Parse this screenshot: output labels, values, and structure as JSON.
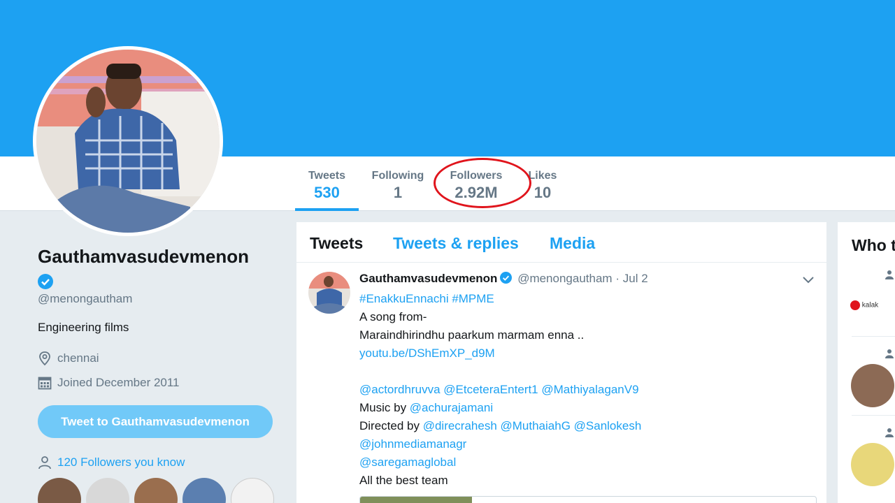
{
  "colors": {
    "brand_blue": "#1da1f2",
    "banner": "#1da1f2",
    "annotation_red": "#e0141c",
    "muted_text": "#657786"
  },
  "nav": {
    "stats": [
      {
        "label": "Tweets",
        "value": "530"
      },
      {
        "label": "Following",
        "value": "1"
      },
      {
        "label": "Followers",
        "value": "2.92M"
      },
      {
        "label": "Likes",
        "value": "10"
      }
    ],
    "active": "Tweets"
  },
  "profile": {
    "name": "Gauthamvasudevmenon",
    "handle": "@menongautham",
    "bio": "Engineering films",
    "location": "chennai",
    "joined": "Joined December 2011",
    "tweet_to_label": "Tweet to Gauthamvasudevmenon",
    "followers_you_know": "120 Followers you know"
  },
  "timeline": {
    "tabs": [
      "Tweets",
      "Tweets & replies",
      "Media"
    ],
    "tweet": {
      "author": "Gauthamvasudevmenon",
      "handle": "@menongautham",
      "date": "Jul 2",
      "lines": [
        {
          "segments": [
            {
              "text": "#EnakkuEnnachi #MPME",
              "link": true
            }
          ]
        },
        {
          "segments": [
            {
              "text": "A song from-",
              "link": false
            }
          ]
        },
        {
          "segments": [
            {
              "text": "Maraindhirindhu paarkum marmam enna ..",
              "link": false
            }
          ]
        },
        {
          "segments": [
            {
              "text": "youtu.be/DShEmXP_d9M",
              "link": true
            }
          ]
        },
        {
          "segments": []
        },
        {
          "segments": [
            {
              "text": "@actordhruvva @EtceteraEntert1 @MathiyalaganV9",
              "link": true
            }
          ]
        },
        {
          "segments": [
            {
              "text": "Music by ",
              "link": false
            },
            {
              "text": "@achurajamani",
              "link": true
            }
          ]
        },
        {
          "segments": [
            {
              "text": "Directed by ",
              "link": false
            },
            {
              "text": "@direcrahesh @MuthaiahG @Sanlokesh",
              "link": true
            }
          ]
        },
        {
          "segments": [
            {
              "text": "@johnmediamanagr",
              "link": true
            }
          ]
        },
        {
          "segments": [
            {
              "text": "@saregamaglobal",
              "link": true
            }
          ]
        },
        {
          "segments": [
            {
              "text": "All the best team",
              "link": false
            }
          ]
        }
      ]
    }
  },
  "who_to_follow": {
    "title": "Who t",
    "first_logo_text": "kalak"
  },
  "icons": [
    "verified-icon",
    "location-pin-icon",
    "calendar-icon",
    "person-icon",
    "chevron-down-icon"
  ]
}
